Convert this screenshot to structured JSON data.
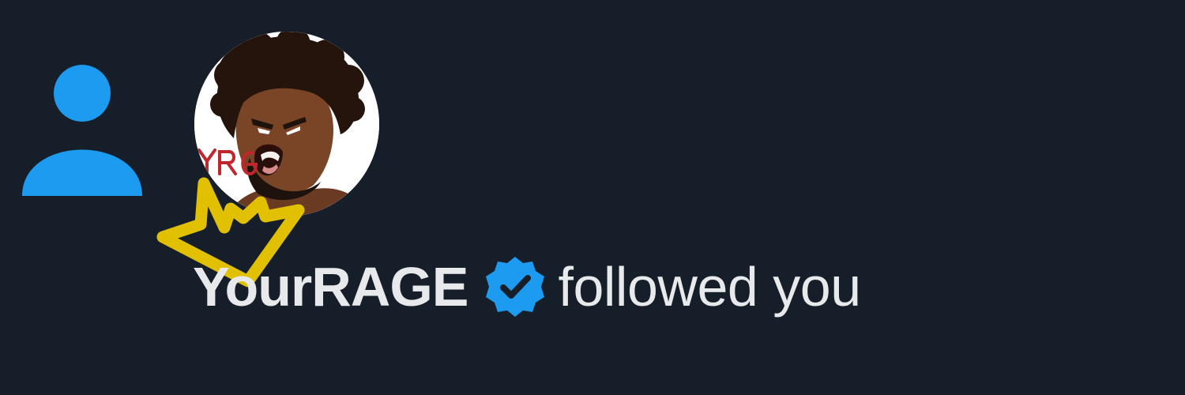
{
  "notification": {
    "type_icon": "person-follow-icon",
    "avatar_icon": "profile-avatar",
    "avatar_mark": "YRG",
    "user_name": "YourRAGE",
    "verified_icon": "verified-badge-icon",
    "action_text": "followed you",
    "overlay_icon": "hand-drawn-crown"
  },
  "colors": {
    "background": "#161e29",
    "accent": "#1d9bf0",
    "text": "#e7e9ea",
    "crown": "#e0c000"
  }
}
